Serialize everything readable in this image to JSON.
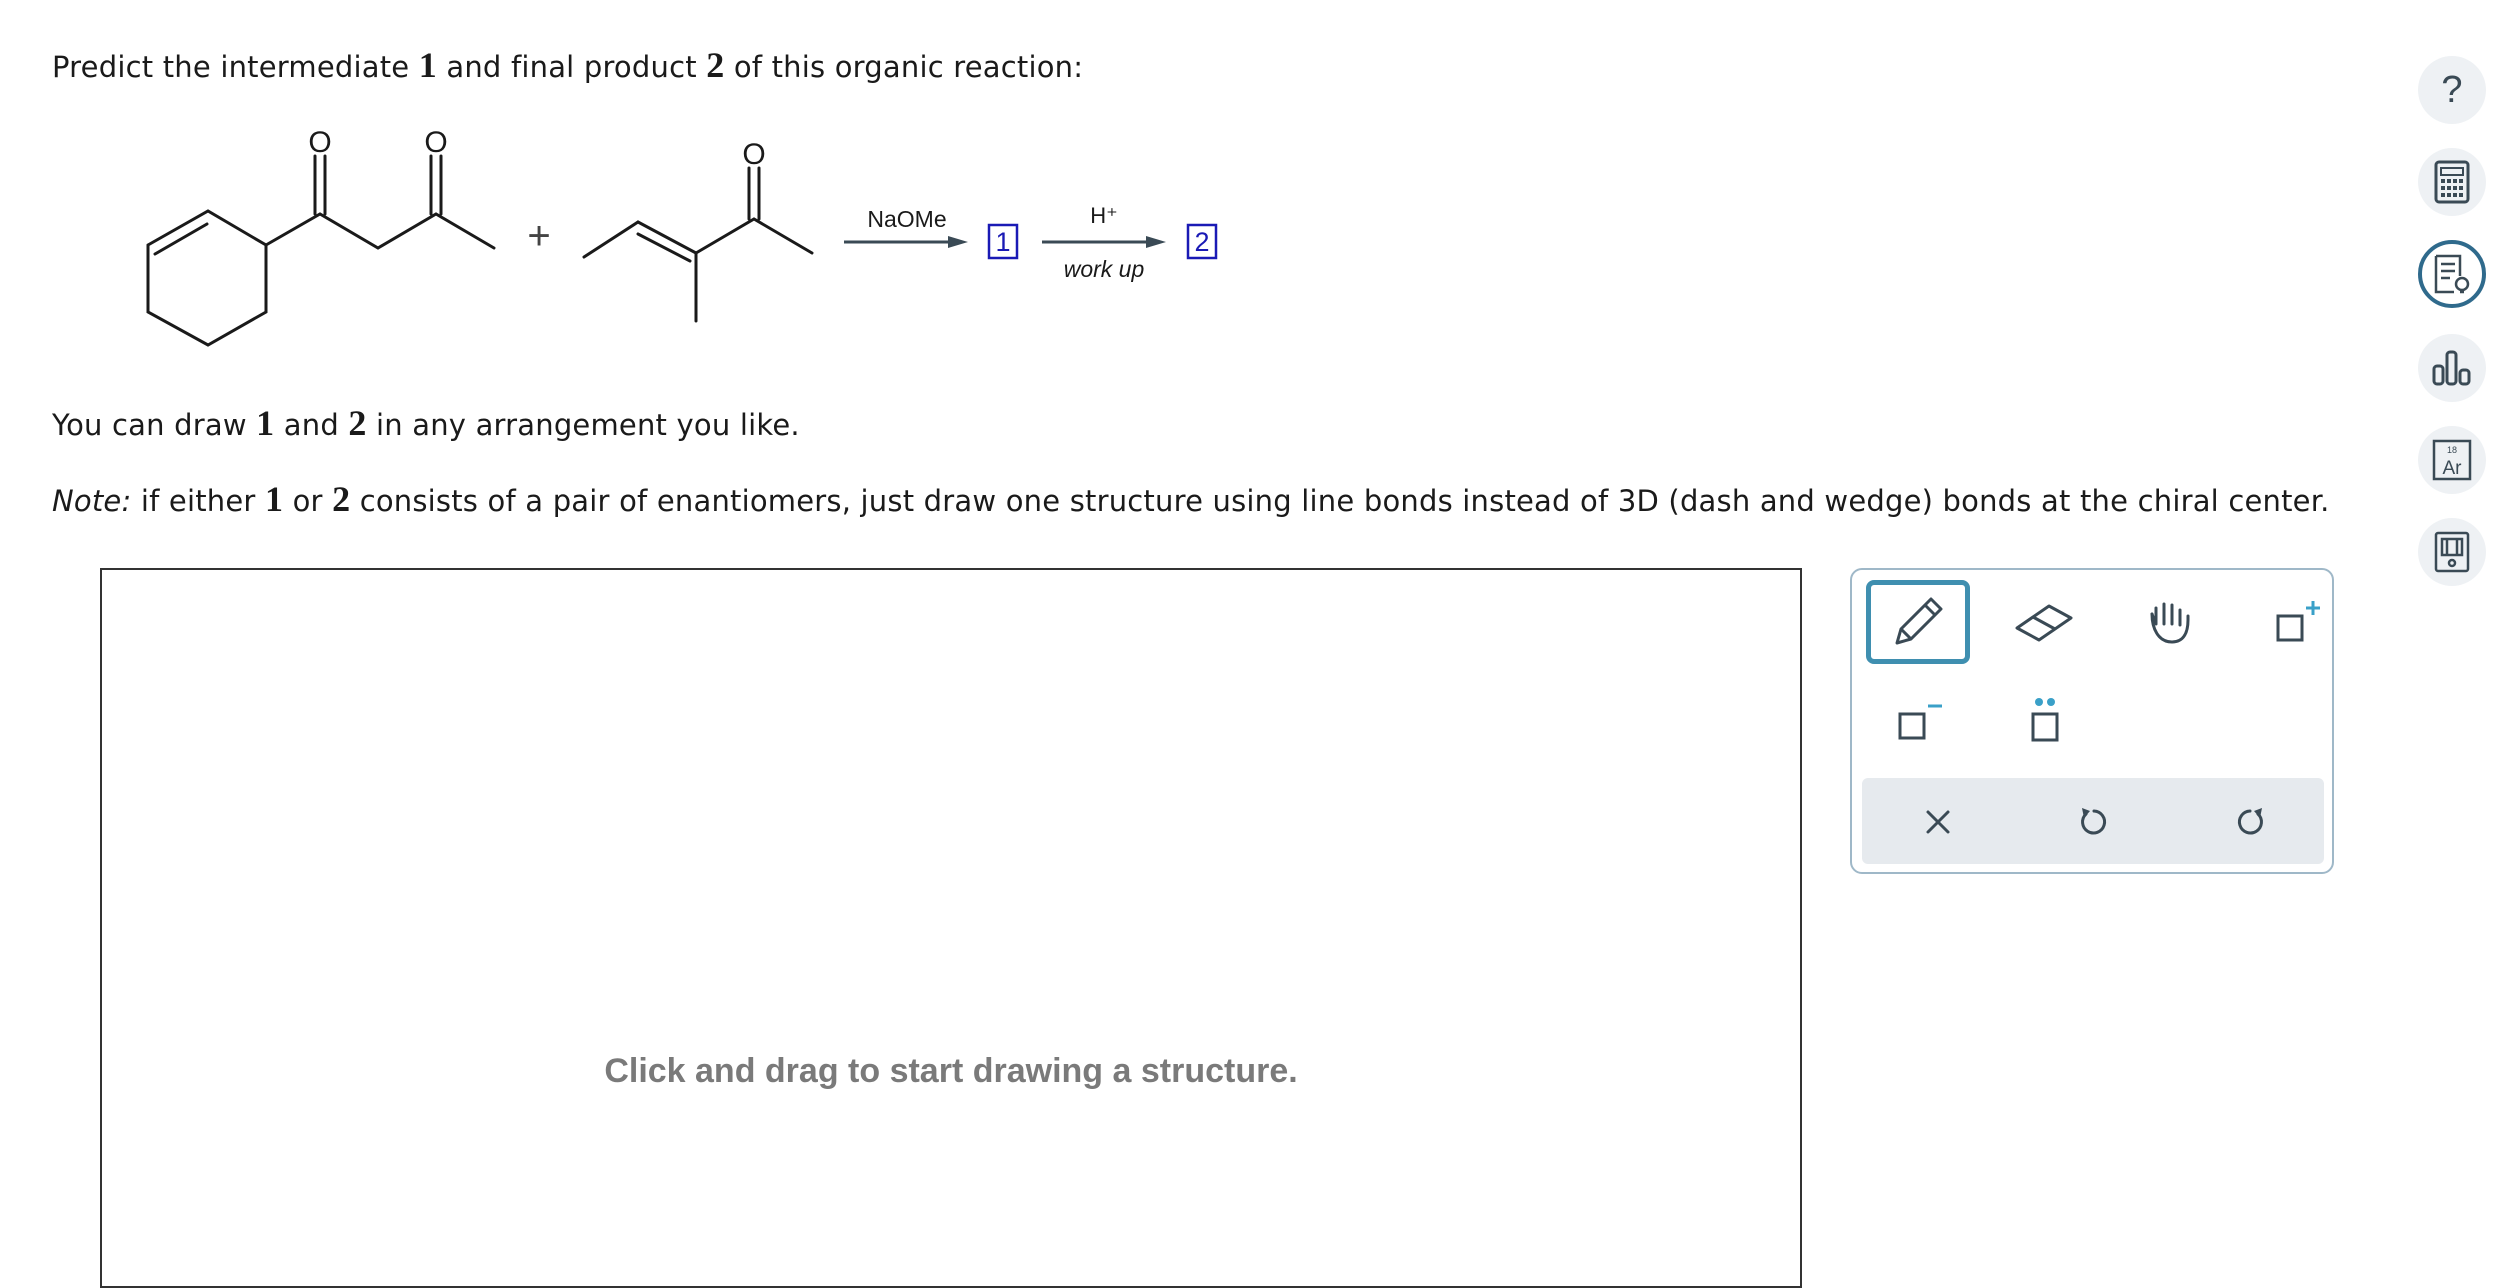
{
  "question": {
    "prompt": [
      "Predict the intermediate ",
      "1",
      " and final product ",
      "2",
      " of this organic reaction:"
    ],
    "arrange": [
      "You can draw ",
      "1",
      " and ",
      "2",
      " in any arrangement you like."
    ],
    "note": [
      "Note:",
      " if either ",
      "1",
      " or ",
      "2",
      " consists of a pair of enantiomers, just draw one structure using line bonds instead of 3D (dash and wedge) bonds at the chiral center."
    ]
  },
  "reaction": {
    "plus": "+",
    "atom_o": "O",
    "reagent1": "NaOMe",
    "reagent2": "H⁺",
    "condition2": "work up",
    "box1": "1",
    "box2": "2"
  },
  "canvas": {
    "hint": "Click and drag to start drawing a structure."
  },
  "toolbox": {
    "tools": [
      "pencil-tool",
      "eraser-tool",
      "move-tool",
      "positive-charge-tool",
      "negative-charge-tool",
      "lone-pair-tool"
    ],
    "actions": [
      "clear-button",
      "undo-button",
      "redo-button"
    ],
    "active_tool": "pencil-tool"
  },
  "sidebar": {
    "help_label": "?",
    "periodic_number": "18",
    "periodic_symbol": "Ar",
    "active": "explanation-icon"
  },
  "colors": {
    "accent": "#3f8fb0",
    "label_blue": "#1a1ab5",
    "tool_icon": "#3a4a55",
    "charge_blue": "#3aa0c8"
  }
}
